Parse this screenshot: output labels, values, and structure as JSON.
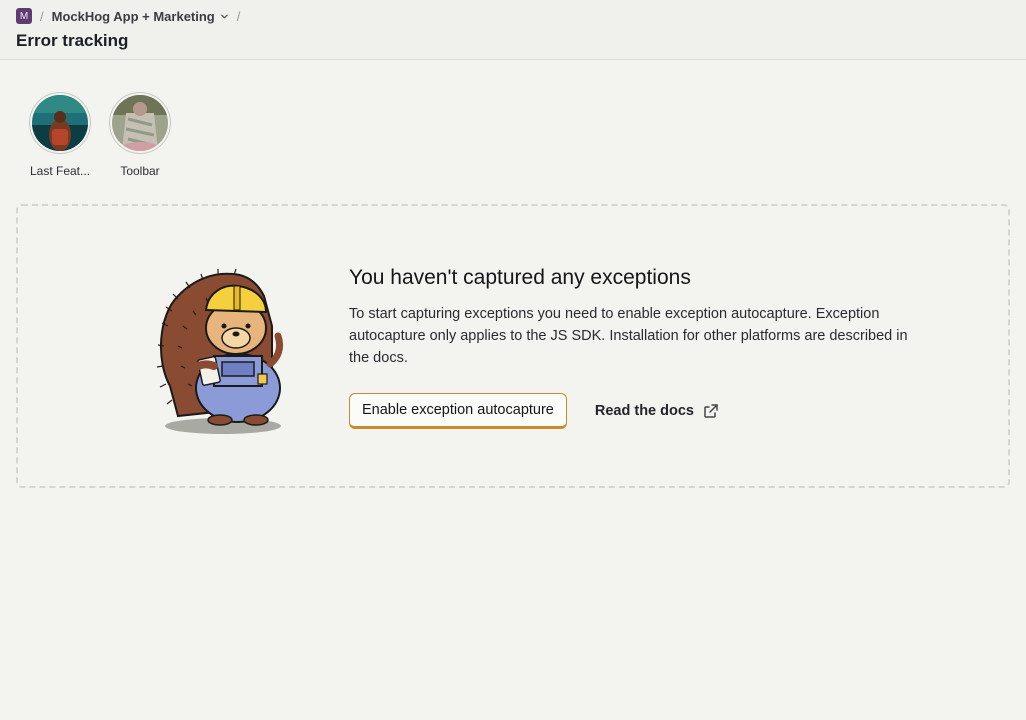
{
  "breadcrumb": {
    "project_initial": "M",
    "separator": "/",
    "project_name": "MockHog App + Marketing",
    "page_title": "Error tracking"
  },
  "stories": [
    {
      "label": "Last Feat..."
    },
    {
      "label": "Toolbar"
    }
  ],
  "empty_state": {
    "title": "You haven't captured any exceptions",
    "description": "To start capturing exceptions you need to enable exception autocapture. Exception autocapture only applies to the JS SDK. Installation for other platforms are described in the docs.",
    "primary_action": "Enable exception autocapture",
    "secondary_action": "Read the docs",
    "illustration": "hedgehog-builder",
    "secondary_icon": "external-link-icon"
  },
  "colors": {
    "background": "#f3f3ef",
    "accent": "#c98b2b",
    "project_badge": "#5f3b71"
  }
}
